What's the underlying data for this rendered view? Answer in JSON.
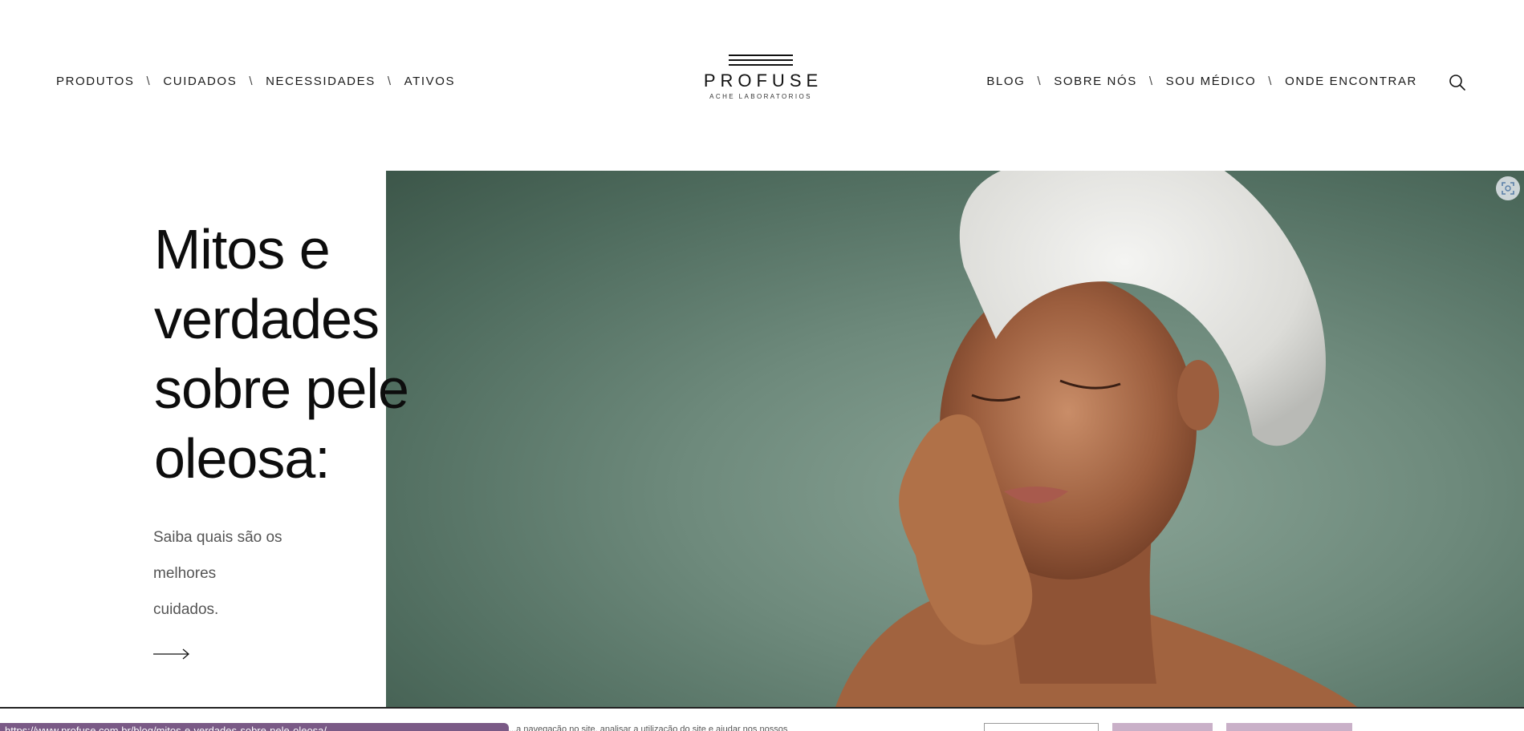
{
  "nav_left": [
    {
      "label": "PRODUTOS"
    },
    {
      "label": "CUIDADOS"
    },
    {
      "label": "NECESSIDADES"
    },
    {
      "label": "ATIVOS"
    }
  ],
  "nav_separator": "\\",
  "logo": {
    "name": "PROFUSE",
    "subtitle": "ACHE LABORATORIOS"
  },
  "nav_right": [
    {
      "label": "BLOG"
    },
    {
      "label": "SOBRE NÓS"
    },
    {
      "label": "SOU MÉDICO"
    },
    {
      "label": "ONDE ENCONTRAR"
    }
  ],
  "icons": {
    "search": "search-icon",
    "arrow": "arrow-right-icon",
    "screenshot": "screenshot-icon"
  },
  "hero": {
    "title_lines": [
      "Mitos e",
      "verdades",
      "sobre pele",
      "oleosa:"
    ],
    "subtitle_lines": [
      "Saiba quais são os",
      "melhores",
      "cuidados."
    ]
  },
  "cookie_bar": {
    "url_text": "https://www.profuse.com.br/blog/mitos-e-verdades-sobre-pele-oleosa/",
    "text": "...a navegação no site, analisar a utilização do site e ajudar nos nossos"
  },
  "colors": {
    "accent_purple": "#7a5a86",
    "button_mauve": "#c9b0c8",
    "hero_bg": "#6e8a7c"
  }
}
